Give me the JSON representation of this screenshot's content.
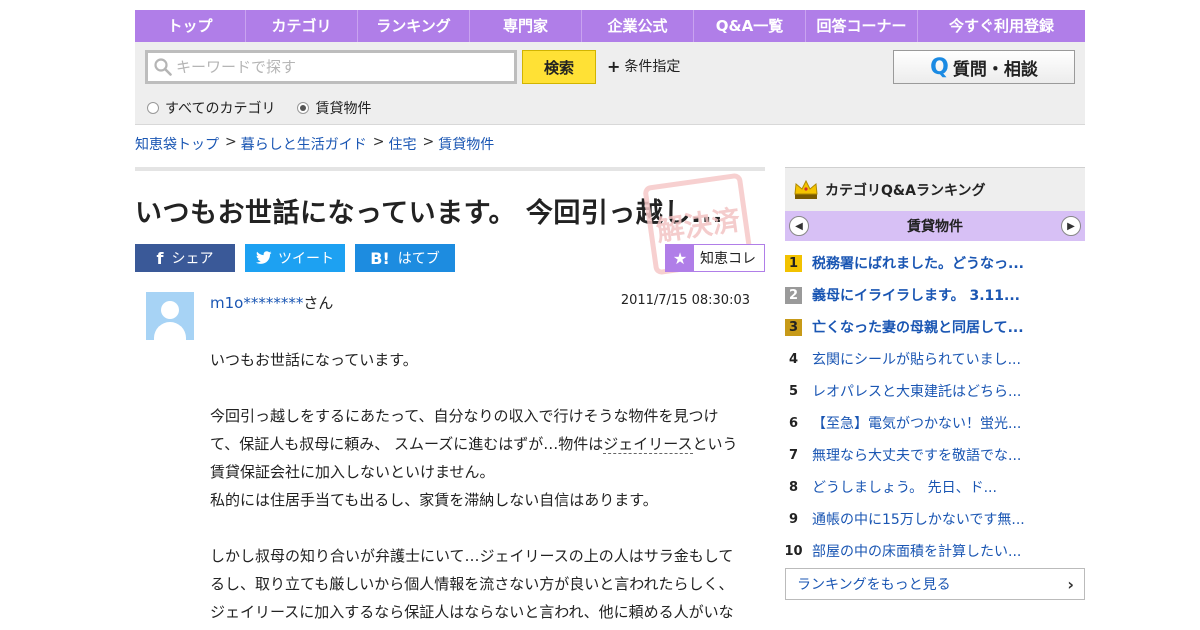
{
  "nav": {
    "items": [
      "トップ",
      "カテゴリ",
      "ランキング",
      "専門家",
      "企業公式",
      "Q&A一覧",
      "回答コーナー",
      "今すぐ利用登録"
    ]
  },
  "search": {
    "placeholder": "キーワードで探す",
    "button_label": "検索",
    "conditions_label": "条件指定",
    "ask_button_label": "質問・相談",
    "radio_all": "すべてのカテゴリ",
    "radio_category": "賃貸物件",
    "selected": "賃貸物件"
  },
  "breadcrumb": [
    "知恵袋トップ",
    "暮らしと生活ガイド",
    "住宅",
    "賃貸物件"
  ],
  "question": {
    "title": "いつもお世話になっています。 今回引っ越し...",
    "share_facebook": "シェア",
    "share_twitter": "ツイート",
    "share_hatena": "はてブ",
    "chiecolle_label": "知恵コレ",
    "author_id": "m1o********",
    "author_suffix": "さん",
    "date": "2011/7/15 08:30:03",
    "body": {
      "p1": "いつもお世話になっています。",
      "p2_a": "今回引っ越しをするにあたって、自分なりの収入で行けそうな物件を見つけて、保証人も叔母に頼み、 スムーズに進むはずが…物件は",
      "p2_kw": "ジェイリース",
      "p2_b": "という賃貸保証会社に加入しないといけません。",
      "p2_c": "私的には住居手当ても出るし、家賃を滞納しない自信はあります。",
      "p3": "しかし叔母の知り合いが弁護士にいて…ジェイリースの上の人はサラ金もしてるし、取り立ても厳しいから個人情報を流さない方が良いと言われたらしく、ジェイリースに加入するなら保証人はならないと言われ、他に頼める人がいなくて…困っています。"
    }
  },
  "sidebar": {
    "title": "カテゴリQ&Aランキング",
    "category": "賃貸物件",
    "ranking": [
      {
        "num": "1",
        "text": "税務署にばれました。どうなっ..."
      },
      {
        "num": "2",
        "text": "義母にイライラします。 3.11..."
      },
      {
        "num": "3",
        "text": "亡くなった妻の母親と同居して..."
      },
      {
        "num": "4",
        "text": "玄関にシールが貼られていまし..."
      },
      {
        "num": "5",
        "text": "レオパレスと大東建託はどちら..."
      },
      {
        "num": "6",
        "text": "【至急】電気がつかない！蛍光..."
      },
      {
        "num": "7",
        "text": "無理なら大丈夫ですを敬語でな..."
      },
      {
        "num": "8",
        "text": "どうしましょう。 先日、ド..."
      },
      {
        "num": "9",
        "text": "通帳の中に15万しかないです無..."
      },
      {
        "num": "10",
        "text": "部屋の中の床面積を計算したい..."
      }
    ],
    "more_label": "ランキングをもっと見る"
  },
  "colors": {
    "nav_purple": "#b07ee8",
    "search_yellow": "#ffe135",
    "link_blue": "#1a56b3",
    "facebook": "#3a5998",
    "twitter": "#1da1f2",
    "hatena": "#1d8ce0"
  },
  "stamp_text": "解決済"
}
